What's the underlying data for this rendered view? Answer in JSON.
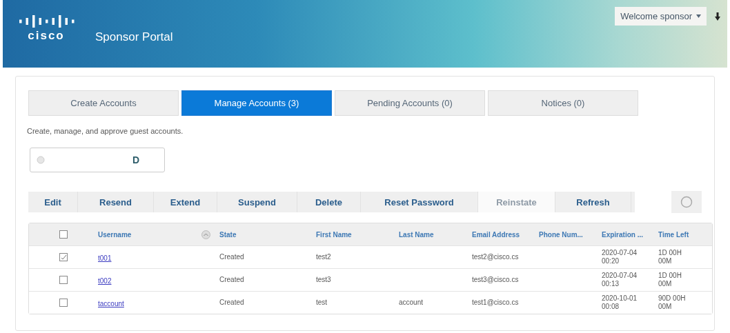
{
  "header": {
    "logo_text": "cisco",
    "title": "Sponsor Portal",
    "user_menu": "Welcome sponsor"
  },
  "tabs": [
    {
      "label": "Create Accounts",
      "selected": false
    },
    {
      "label": "Manage Accounts (3)",
      "selected": true
    },
    {
      "label": "Pending Accounts (0)",
      "selected": false
    },
    {
      "label": "Notices (0)",
      "selected": false
    }
  ],
  "description": "Create, manage, and approve guest accounts.",
  "search": {
    "value": "D"
  },
  "actions": [
    {
      "label": "Edit",
      "disabled": false
    },
    {
      "label": "Resend",
      "disabled": false
    },
    {
      "label": "Extend",
      "disabled": false
    },
    {
      "label": "Suspend",
      "disabled": false
    },
    {
      "label": "Delete",
      "disabled": false
    },
    {
      "label": "Reset Password",
      "disabled": false
    },
    {
      "label": "Reinstate",
      "disabled": true
    },
    {
      "label": "Refresh",
      "disabled": false
    }
  ],
  "table": {
    "select_all": {
      "checked": false
    },
    "columns": [
      "Username",
      "State",
      "First Name",
      "Last Name",
      "Email Address",
      "Phone Num...",
      "Expiration ...",
      "Time Left"
    ],
    "rows": [
      {
        "checked": true,
        "cells": [
          "t001",
          "Created",
          "test2",
          "",
          "test2@cisco.cs",
          "",
          "2020-07-04 00:20",
          "1D 00H 00M"
        ]
      },
      {
        "checked": false,
        "cells": [
          "t002",
          "Created",
          "test3",
          "",
          "test3@cisco.cs",
          "",
          "2020-07-04 00:13",
          "1D 00H 00M"
        ]
      },
      {
        "checked": false,
        "cells": [
          "taccount",
          "Created",
          "test",
          "account",
          "test1@cisco.cs",
          "",
          "2020-10-01 00:08",
          "90D 00H 00M"
        ]
      }
    ]
  }
}
